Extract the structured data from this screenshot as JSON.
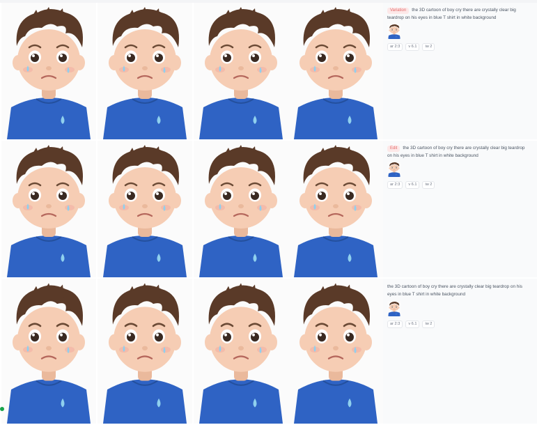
{
  "colors": {
    "hair": "#5a3a28",
    "skin": "#f6cdb4",
    "shirt": "#2f63c4",
    "tear": "#8fd0ee",
    "eye": "#3a2a22",
    "tag_bg": "#fde8e8",
    "tag_text": "#e26b6b"
  },
  "jobs": [
    {
      "tag": "Variation",
      "prompt": "the 3D cartoon of boy cry there are crystally clear big teardrop on his eyes in blue T shirt in white background",
      "params": [
        "ar 2:3",
        "v 6.1",
        "iw 2"
      ]
    },
    {
      "tag": "Edit",
      "prompt": "the 3D cartoon of boy cry there are crystally clear big teardrop on his eyes in blue T shirt in white background",
      "params": [
        "ar 2:3",
        "v 6.1",
        "iw 2"
      ]
    },
    {
      "tag": "",
      "prompt": "the 3D cartoon of boy cry there are crystally clear big teardrop on his eyes in blue T shirt in white background",
      "params": [
        "ar 2:3",
        "v 6.1",
        "iw 2"
      ]
    }
  ]
}
